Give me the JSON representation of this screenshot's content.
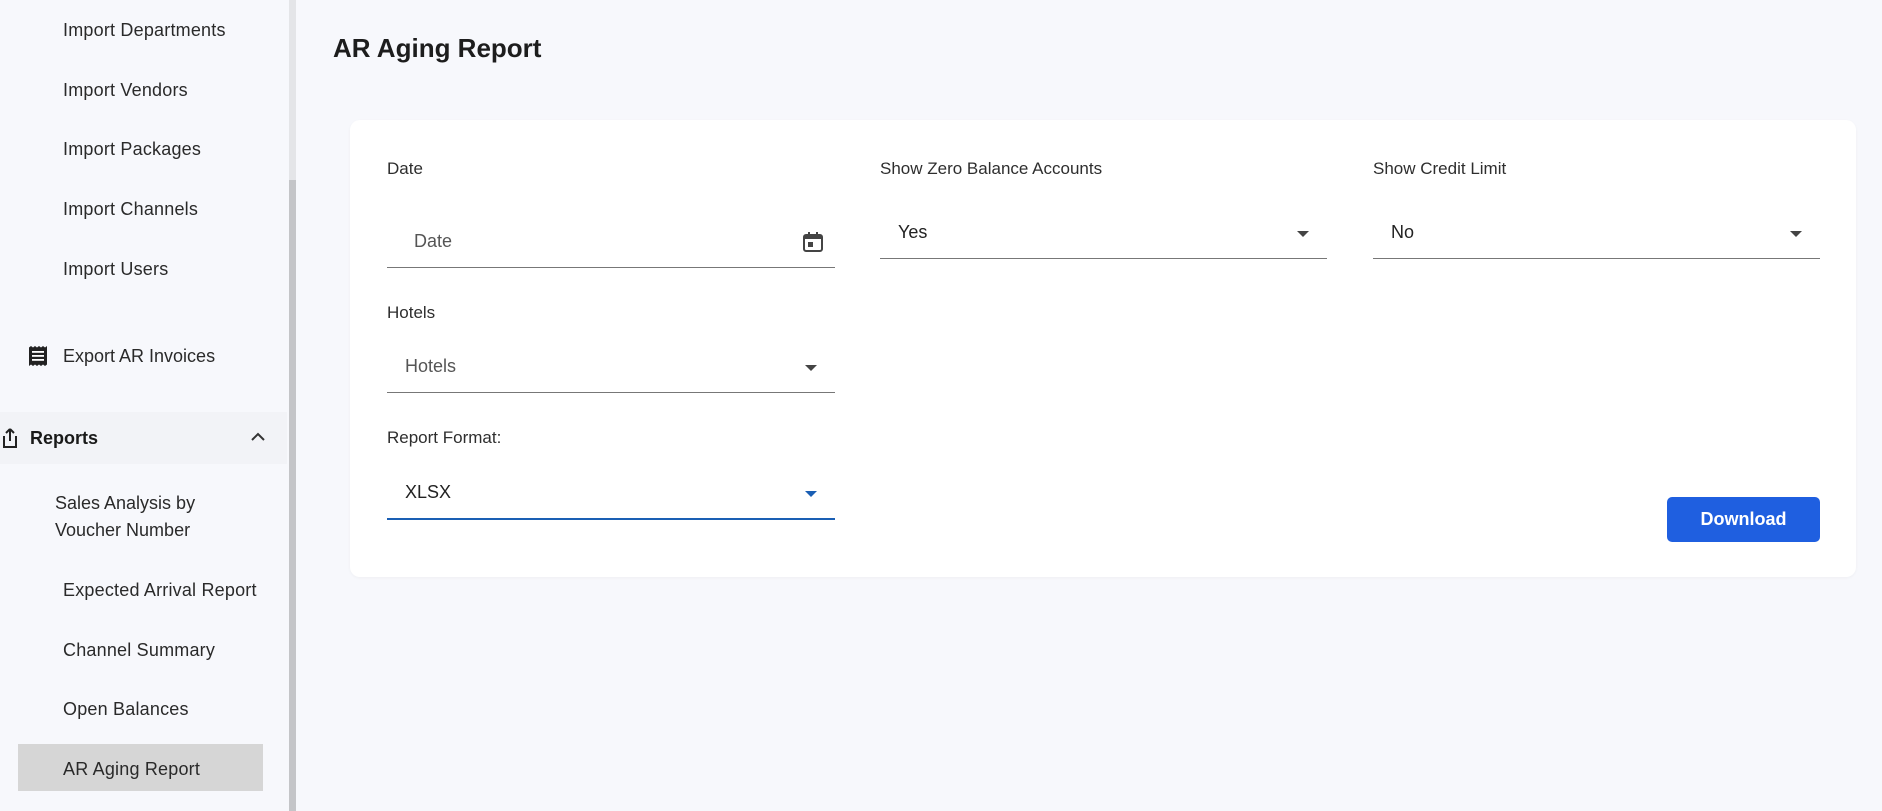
{
  "sidebar": {
    "import_items": [
      "Import Departments",
      "Import Vendors",
      "Import Packages",
      "Import Channels",
      "Import Users"
    ],
    "export_label": "Export AR Invoices",
    "export_icon": "receipt-icon",
    "reports_label": "Reports",
    "reports_icon": "share-upload-icon",
    "reports_chevron": "chevron-up-icon",
    "report_items": [
      "Sales Analysis by",
      "Voucher Number",
      "Expected Arrival Report",
      "Channel Summary",
      "Open Balances",
      "AR Aging Report"
    ]
  },
  "page": {
    "title": "AR Aging Report"
  },
  "form": {
    "date": {
      "label": "Date",
      "placeholder": "Date",
      "icon": "calendar-icon"
    },
    "zero_balance": {
      "label": "Show Zero Balance Accounts",
      "value": "Yes"
    },
    "credit_limit": {
      "label": "Show Credit Limit",
      "value": "No"
    },
    "hotels": {
      "label": "Hotels",
      "placeholder": "Hotels"
    },
    "report_format": {
      "label": "Report Format:",
      "value": "XLSX"
    },
    "download_label": "Download"
  },
  "colors": {
    "accent": "#1f5fe0",
    "active_underline": "#1a5fb4",
    "background": "#f7f8fc",
    "active_nav": "#d6d6d6"
  }
}
